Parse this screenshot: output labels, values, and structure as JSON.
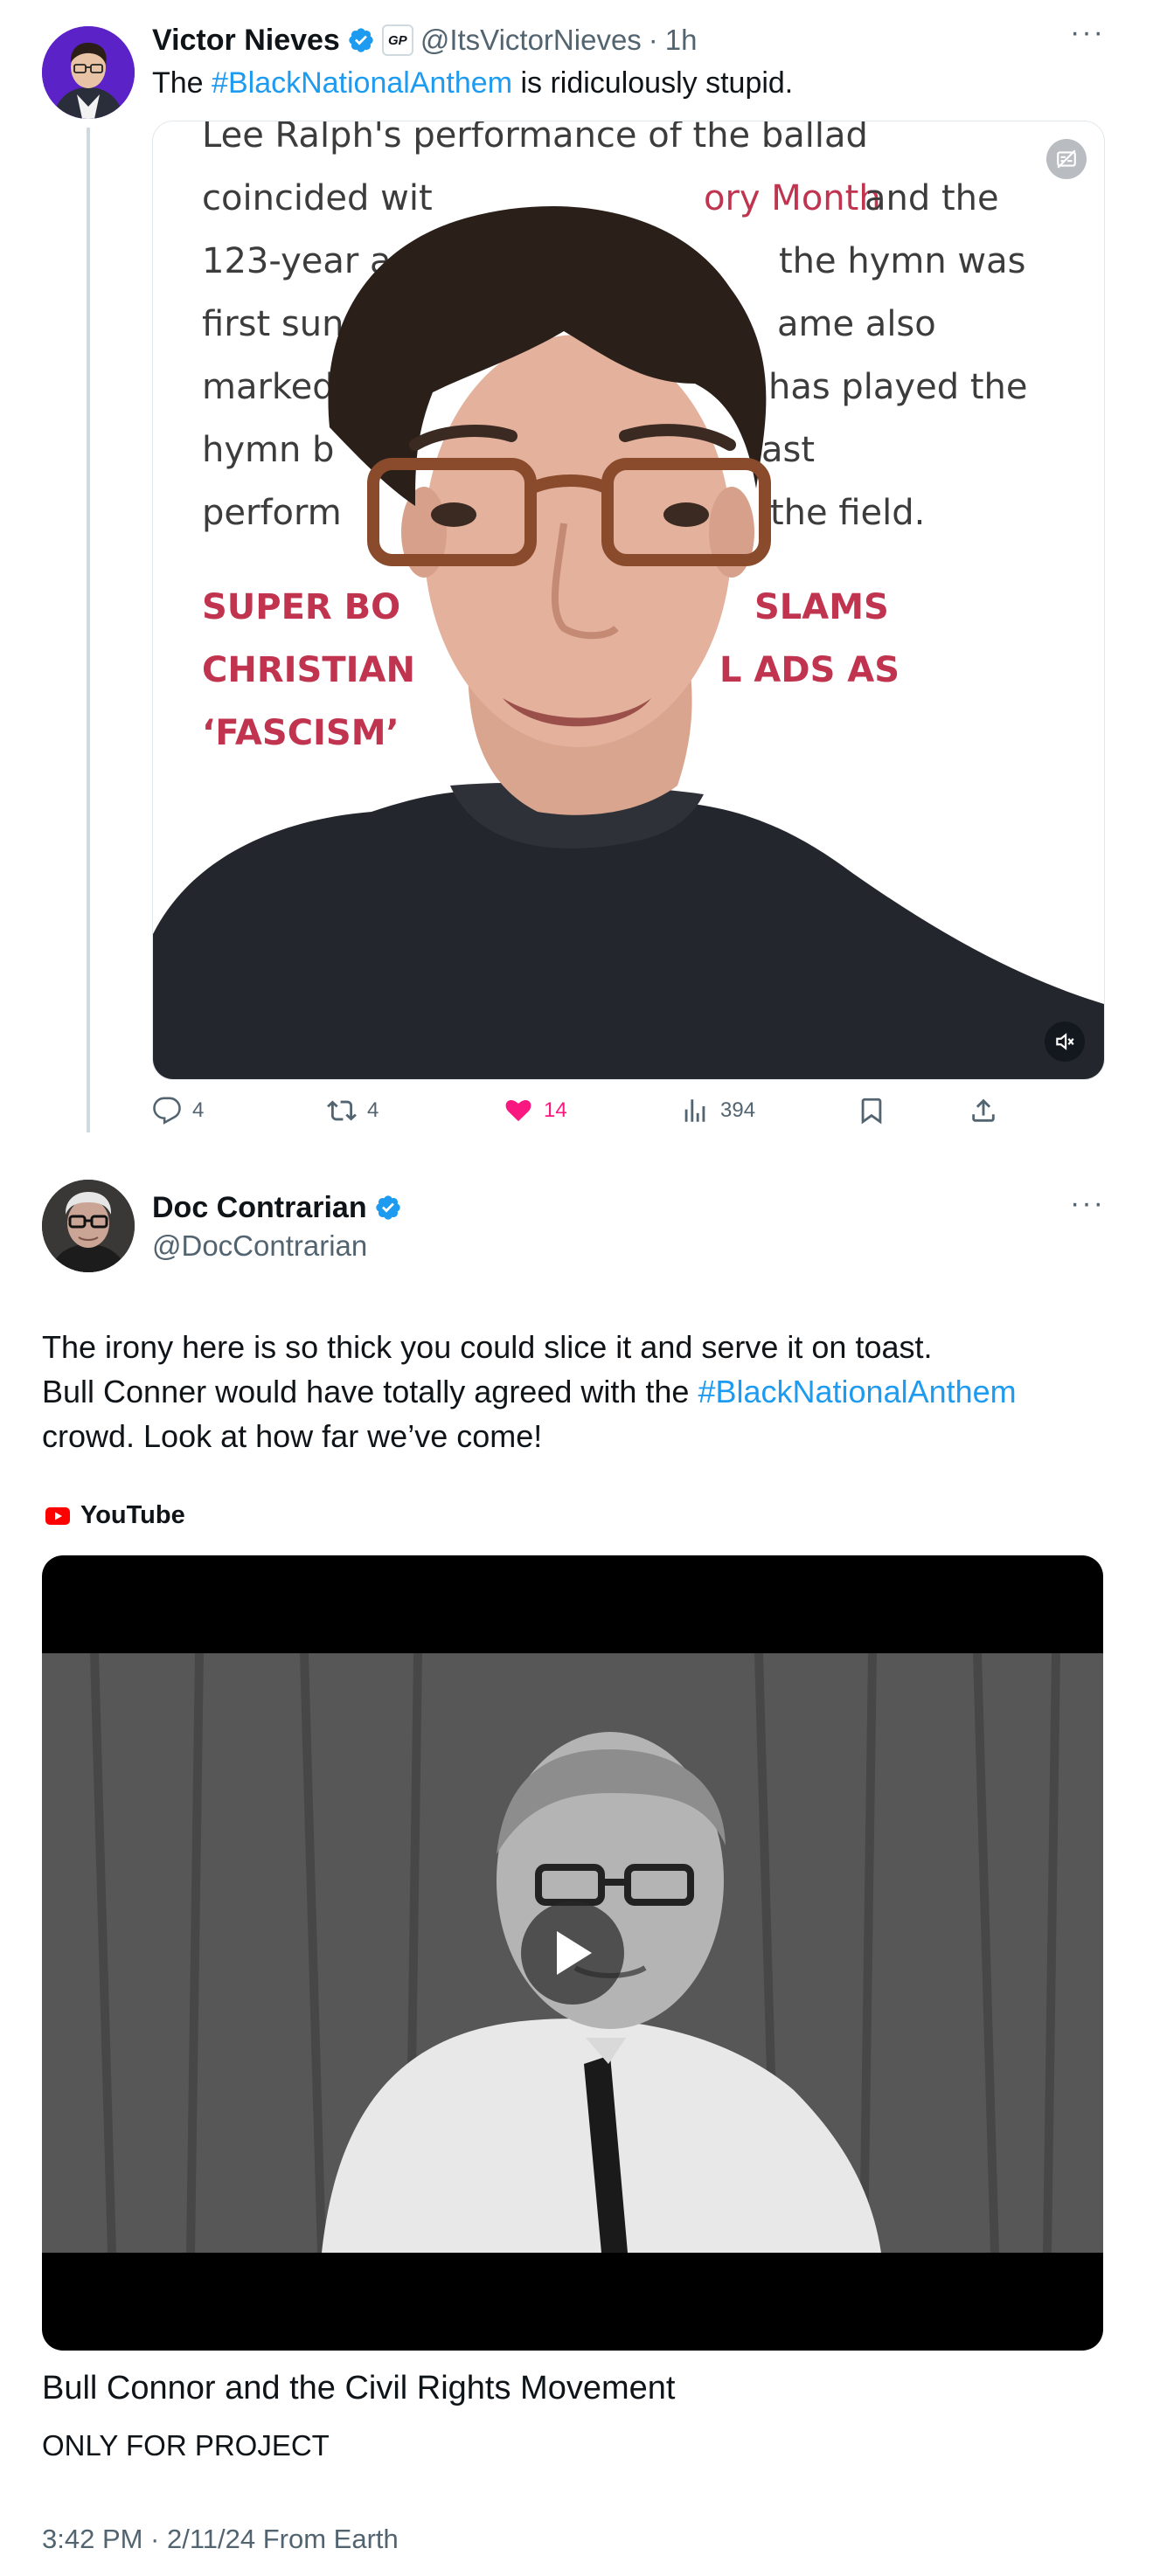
{
  "tweet1": {
    "author_name": "Victor Nieves",
    "affiliation_badge": "GP",
    "handle": "@ItsVictorNieves",
    "separator": "·",
    "time": "1h",
    "text_before": "The ",
    "hashtag": "#BlackNationalAnthem",
    "text_after": " is ridiculously stupid.",
    "video_overlay": {
      "partial_top_line": "Lee Ralph's performance of the ballad",
      "lines": [
        {
          "a": "coincided wit",
          "b": "ory Month",
          "c": " and the"
        },
        {
          "a": "123-year a",
          "b": "",
          "c": "the hymn was"
        },
        {
          "a": "first sun",
          "b": "",
          "c": "ame also"
        },
        {
          "a": "marked",
          "b": "",
          "c": "has played the"
        },
        {
          "a": "hymn b",
          "b": "",
          "c": "ast"
        },
        {
          "a": "perform",
          "b": "",
          "c": "the field."
        }
      ],
      "headline_lines": [
        {
          "a": "SUPER BO",
          "c": "SLAMS"
        },
        {
          "a": "CHRISTIAN",
          "c": "L ADS AS"
        },
        {
          "a": "‘FASCISM’",
          "c": ""
        }
      ]
    },
    "metrics": {
      "replies": "4",
      "reposts": "4",
      "likes": "14",
      "views": "394"
    }
  },
  "tweet2": {
    "author_name": "Doc Contrarian",
    "handle": "@DocContrarian",
    "line1": "The irony here is so thick you could slice it and serve it on toast.",
    "line2_before": "Bull Conner would have totally agreed with the ",
    "hashtag": "#BlackNationalAnthem",
    "line3": "crowd. Look at how far we’ve come!",
    "source_label": "YouTube",
    "video_title": "Bull Connor and the Civil Rights Movement",
    "video_subtitle": "ONLY FOR PROJECT",
    "timestamp": "3:42 PM · 2/11/24 From Earth"
  },
  "colors": {
    "link": "#1d9bf0",
    "like_pink": "#f91880",
    "verified_blue": "#1d9bf0",
    "overlay_red": "#c0344f",
    "youtube_red": "#ff0000"
  }
}
